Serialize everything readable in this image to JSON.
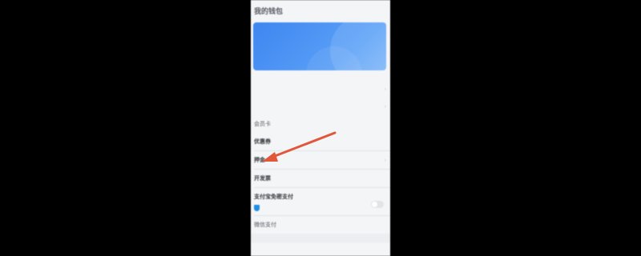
{
  "header": {
    "title": "我的钱包"
  },
  "card": {
    "label": "",
    "link": ""
  },
  "rows": {
    "r1": {
      "label": "",
      "value": ""
    },
    "r2": {
      "label": "",
      "value": ""
    },
    "member_card": {
      "label": "会员卡"
    },
    "coupon": {
      "label": "优惠券"
    },
    "deposit": {
      "label": "押金",
      "value": ""
    },
    "invoice": {
      "label": "开发票"
    },
    "alipay": {
      "label": "支付宝免密支付",
      "desc_line1": "",
      "desc_line2": ""
    },
    "wechat": {
      "label": "微信支付"
    }
  },
  "annotation": {
    "arrow_color": "#e0573a"
  }
}
